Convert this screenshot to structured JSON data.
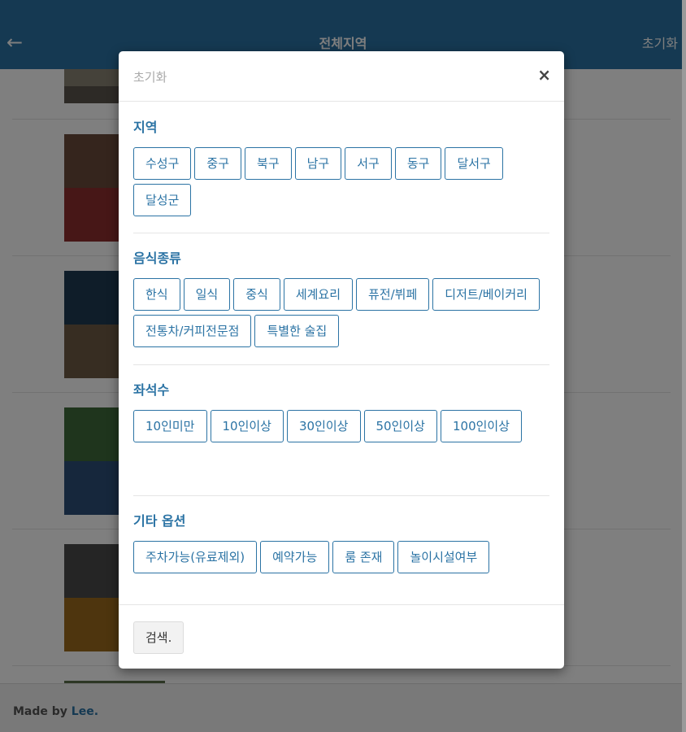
{
  "header": {
    "title": "전체지역",
    "reset_label": "초기화",
    "back_icon": "←"
  },
  "footer": {
    "prefix": "Made by ",
    "name": "Lee."
  },
  "modal": {
    "title": "초기화",
    "close": "×",
    "sections": [
      {
        "title": "지역",
        "options": [
          "수성구",
          "중구",
          "북구",
          "남구",
          "서구",
          "동구",
          "달서구",
          "달성군"
        ]
      },
      {
        "title": "음식종류",
        "options": [
          "한식",
          "일식",
          "중식",
          "세계요리",
          "퓨전/뷔페",
          "디저트/베이커리",
          "전통차/커피전문점",
          "특별한 술집"
        ]
      },
      {
        "title": "좌석수",
        "options": [
          "10인미만",
          "10인이상",
          "30인이상",
          "50인이상",
          "100인이상"
        ]
      },
      {
        "title": "기타 옵션",
        "options": [
          "주차가능(유료제외)",
          "예약가능",
          "룸 존재",
          "놀이시설여부"
        ]
      }
    ],
    "search_label": "검색."
  },
  "colors": {
    "accent": "#2b73a4",
    "header_bg": "#2b73a4"
  }
}
